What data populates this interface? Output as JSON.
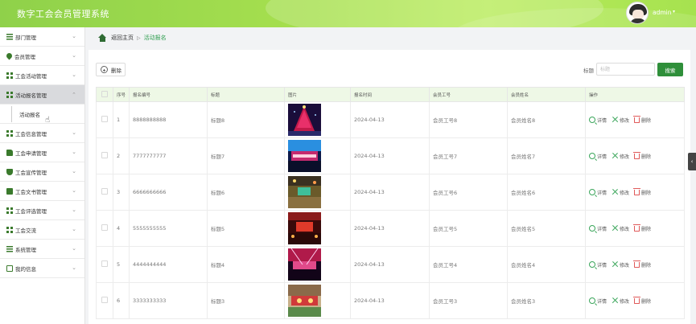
{
  "header": {
    "title": "数字工会会员管理系统",
    "username": "admin",
    "caret": "▾"
  },
  "sidebar": {
    "items": [
      {
        "label": "部门管理",
        "icon": "list-icon"
      },
      {
        "label": "会员管理",
        "icon": "drop-icon"
      },
      {
        "label": "工会活动管理",
        "icon": "grid-icon"
      },
      {
        "label": "活动报名管理",
        "icon": "grid-icon",
        "active": true,
        "expanded": true
      },
      {
        "label": "工会信息管理",
        "icon": "grid-icon"
      },
      {
        "label": "工会申请管理",
        "icon": "thumb-icon"
      },
      {
        "label": "工会宣传管理",
        "icon": "shield-icon"
      },
      {
        "label": "工会文书管理",
        "icon": "folder-icon"
      },
      {
        "label": "工会评选管理",
        "icon": "grid-icon"
      },
      {
        "label": "工会交流",
        "icon": "grid-icon"
      },
      {
        "label": "系统管理",
        "icon": "list-icon"
      },
      {
        "label": "我的信息",
        "icon": "box-icon"
      }
    ],
    "sub_item": "活动报名",
    "chevron": "⌄"
  },
  "breadcrumb": {
    "home": "返回主页",
    "separator": "▷",
    "current": "活动报名"
  },
  "toolbar": {
    "delete_label": "删除",
    "search_label": "标题",
    "search_placeholder": "标题",
    "search_button": "搜索"
  },
  "table": {
    "columns": [
      "序号",
      "报名编号",
      "标题",
      "图片",
      "报名时间",
      "会员工号",
      "会员姓名",
      "操作"
    ],
    "rows": [
      {
        "index": "1",
        "code": "8888888888",
        "title": "标题8",
        "date": "2024-04-13",
        "member_no": "会员工号8",
        "member_name": "会员姓名8",
        "image": "tree"
      },
      {
        "index": "2",
        "code": "7777777777",
        "title": "标题7",
        "date": "2024-04-13",
        "member_no": "会员工号7",
        "member_name": "会员姓名7",
        "image": "stage-blue"
      },
      {
        "index": "3",
        "code": "6666666666",
        "title": "标题6",
        "date": "2024-04-13",
        "member_no": "会员工号6",
        "member_name": "会员姓名6",
        "image": "mall"
      },
      {
        "index": "4",
        "code": "5555555555",
        "title": "标题5",
        "date": "2024-04-13",
        "member_no": "会员工号5",
        "member_name": "会员姓名5",
        "image": "hall"
      },
      {
        "index": "5",
        "code": "4444444444",
        "title": "标题4",
        "date": "2024-04-13",
        "member_no": "会员工号4",
        "member_name": "会员姓名4",
        "image": "stage-red"
      },
      {
        "index": "6",
        "code": "3333333333",
        "title": "标题3",
        "date": "2024-04-13",
        "member_no": "会员工号3",
        "member_name": "会员姓名3",
        "image": "market"
      }
    ],
    "actions": {
      "detail": "详情",
      "edit": "修改",
      "delete": "删除"
    }
  },
  "colors": {
    "header_green": "#a6e24f",
    "primary_green": "#2f8f3a",
    "table_header_bg": "#eef8e6",
    "delete_red": "#e05a5a"
  }
}
